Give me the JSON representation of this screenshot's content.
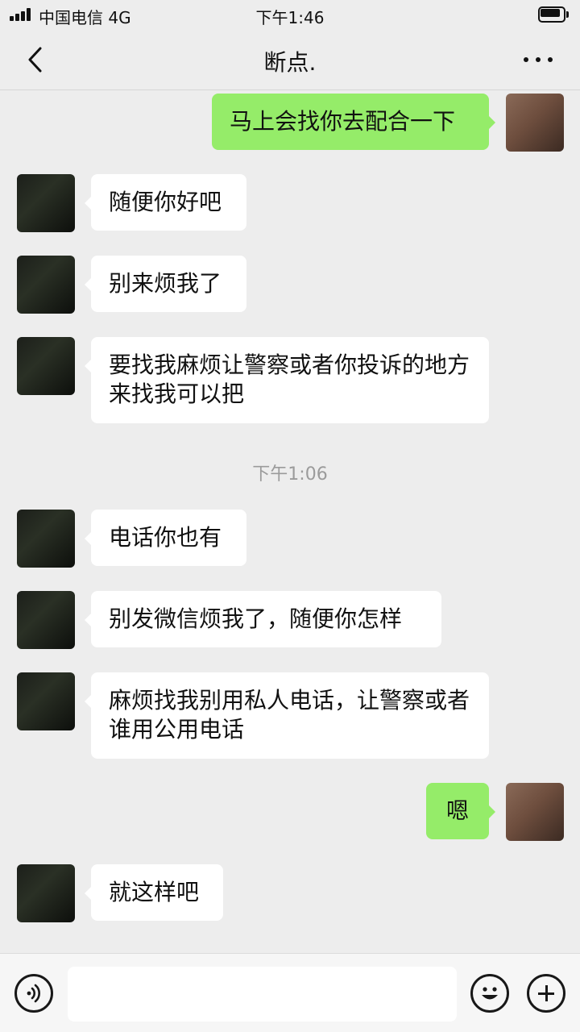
{
  "status_bar": {
    "carrier": "中国电信 4G",
    "time": "下午1:46"
  },
  "nav": {
    "title": "断点."
  },
  "messages": [
    {
      "side": "out",
      "text": "马上会找你去配合一下"
    },
    {
      "side": "in",
      "text": "随便你好吧"
    },
    {
      "side": "in",
      "text": "别来烦我了"
    },
    {
      "side": "in",
      "text": "要找我麻烦让警察或者你投诉的地方来找我可以把"
    },
    {
      "side": "in",
      "text": "电话你也有"
    },
    {
      "side": "in",
      "text": "别发微信烦我了，随便你怎样"
    },
    {
      "side": "in",
      "text": "麻烦找我别用私人电话，让警察或者谁用公用电话"
    },
    {
      "side": "out",
      "text": "嗯"
    },
    {
      "side": "in",
      "text": "就这样吧"
    }
  ],
  "timestamp": "下午1:06",
  "input": {
    "placeholder": ""
  },
  "icons": {
    "back": "chevron-left-icon",
    "more": "more-dots-icon",
    "voice": "voice-icon",
    "emoji": "emoji-icon",
    "plus": "plus-icon"
  },
  "colors": {
    "background": "#ededed",
    "bubble_out": "#95ec69",
    "bubble_in": "#ffffff",
    "timestamp": "#9b9b9b"
  }
}
